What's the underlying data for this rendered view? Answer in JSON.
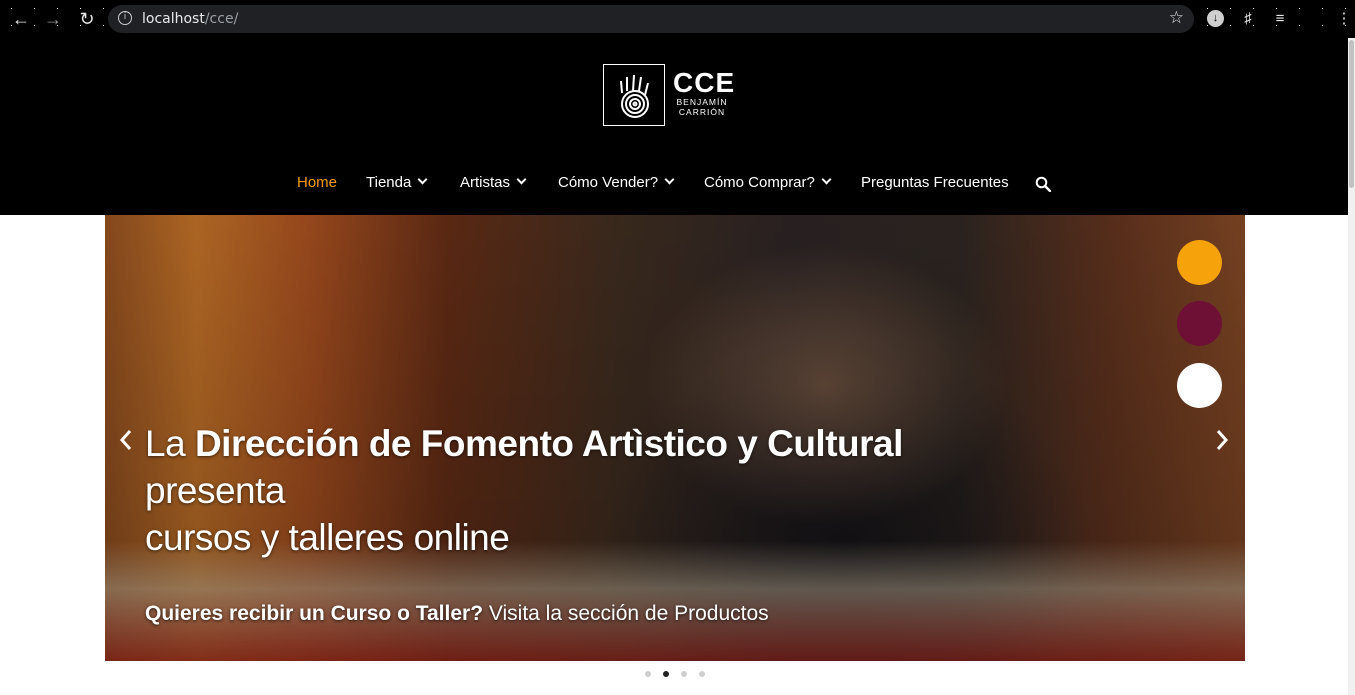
{
  "browser": {
    "url_host": "localhost",
    "url_path": "/cce/"
  },
  "logo": {
    "title": "CCE",
    "line1": "BENJAMÍN",
    "line2": "CARRIÓN"
  },
  "menu": {
    "items": [
      {
        "label": "Home",
        "active": true,
        "dropdown": false
      },
      {
        "label": "Tienda",
        "active": false,
        "dropdown": true
      },
      {
        "label": "Artistas",
        "active": false,
        "dropdown": true
      },
      {
        "label": "Cómo Vender?",
        "active": false,
        "dropdown": true
      },
      {
        "label": "Cómo Comprar?",
        "active": false,
        "dropdown": true
      },
      {
        "label": "Preguntas Frecuentes",
        "active": false,
        "dropdown": false
      }
    ],
    "active_color": "#f39c12"
  },
  "slide": {
    "headline_pre": "La ",
    "headline_bold": "Dirección de Fomento Artìstico y Cultural",
    "headline_mid": " presenta",
    "headline_line2": "cursos y talleres online",
    "sub_bold": "Quieres recibir un Curso o Taller?",
    "sub_rest": " Visita la sección de Productos",
    "prev_icon": "chevron-left-icon",
    "next_icon": "chevron-right-icon"
  },
  "color_switcher": [
    "#f5a20b",
    "#6e0f35",
    "#ffffff"
  ],
  "pagination": {
    "count": 4,
    "active_index": 1
  }
}
